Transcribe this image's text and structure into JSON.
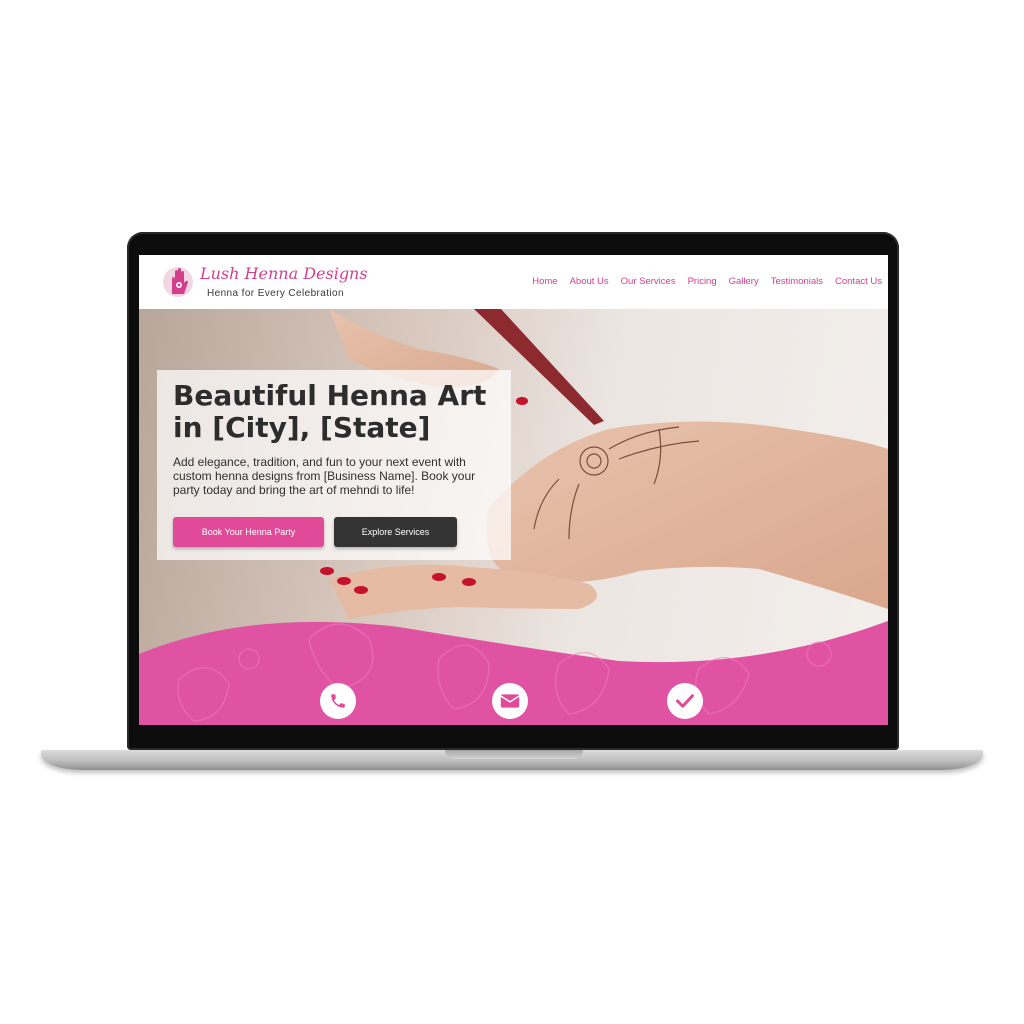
{
  "brand": {
    "name": "Lush Henna Designs",
    "tagline": "Henna for Every Celebration"
  },
  "nav": {
    "items": [
      "Home",
      "About Us",
      "Our Services",
      "Pricing",
      "Gallery",
      "Testimonials",
      "Contact Us"
    ]
  },
  "hero": {
    "title": "Beautiful Henna Art in [City], [State]",
    "body": "Add elegance, tradition, and fun to your next event with custom henna designs from [Business Name]. Book your party today and bring the art of mehndi to life!",
    "primary_button": "Book Your Henna Party",
    "secondary_button": "Explore Services"
  },
  "feature_icons": [
    "phone-icon",
    "envelope-icon",
    "checkmark-icon"
  ],
  "colors": {
    "accent": "#e04a98",
    "accent_text": "#d43f8d",
    "dark_button": "#343434",
    "wave": "#e052a2"
  }
}
